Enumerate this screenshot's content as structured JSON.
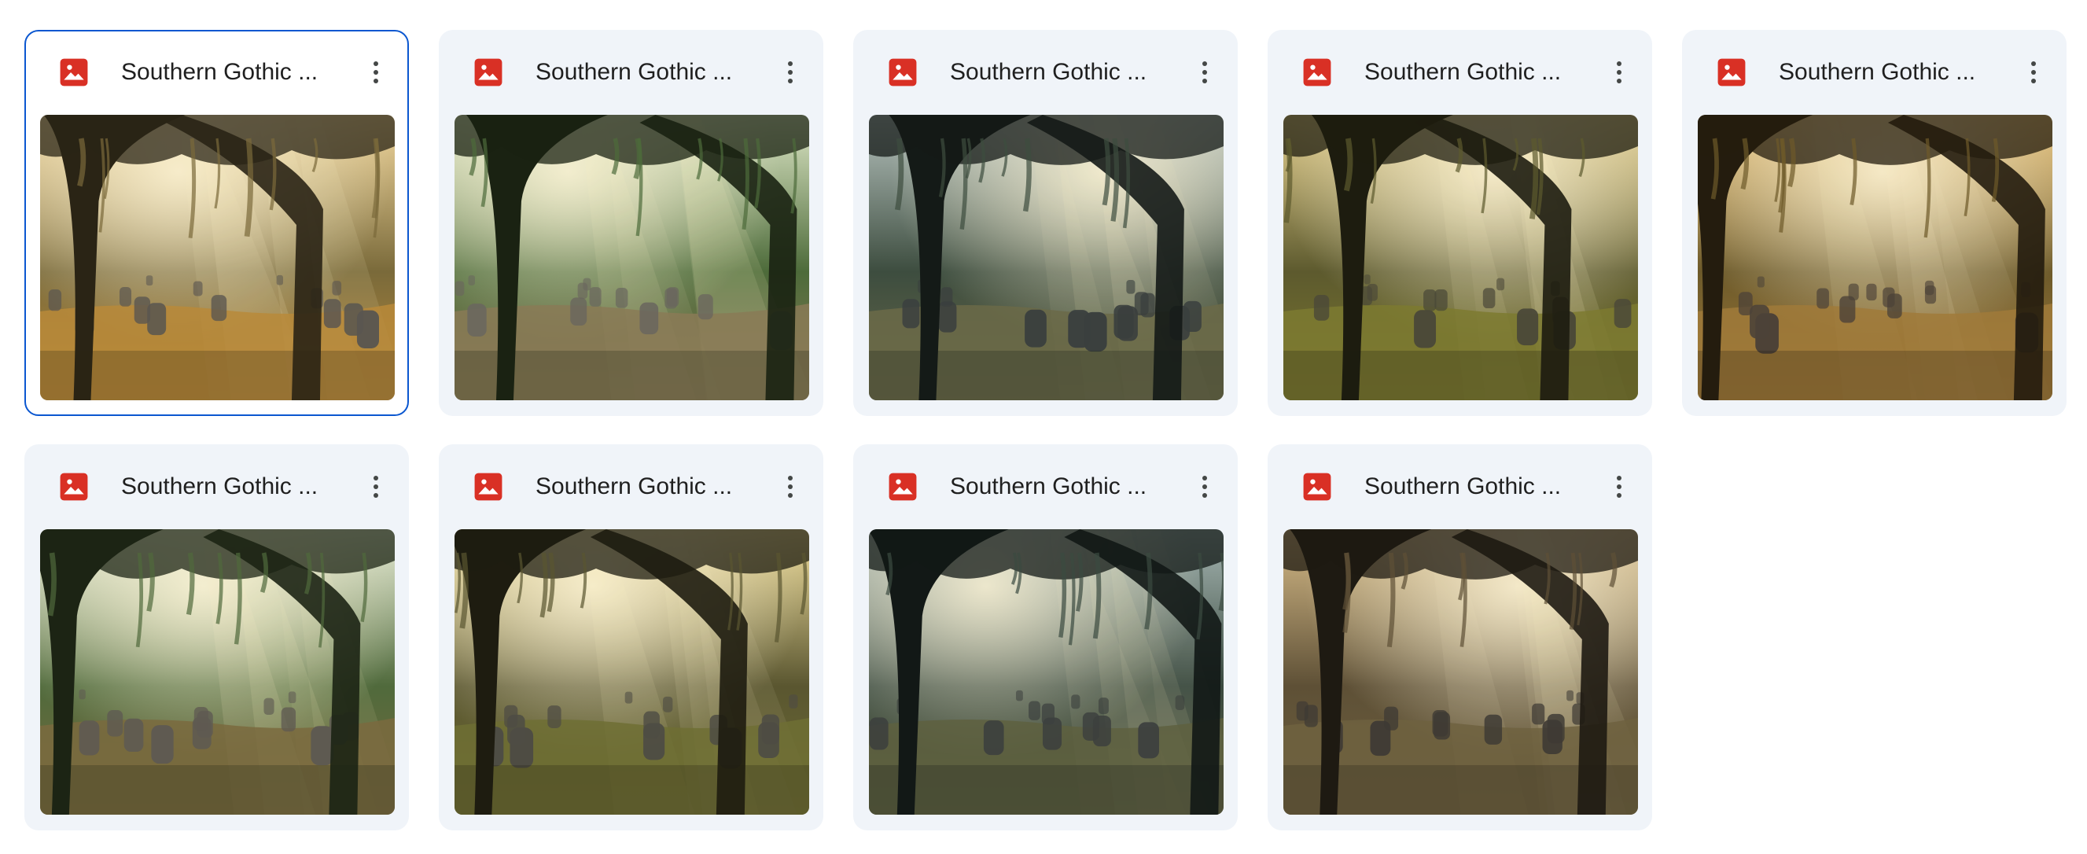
{
  "files": [
    {
      "name": "Southern Gothic ...",
      "type_icon": "image-file-icon",
      "more_icon": "more-vert-icon",
      "selected": true,
      "palette": {
        "sky": "#f3d9a0",
        "mid": "#7a6a3a",
        "dark": "#2a2415",
        "ground": "#b98a3a",
        "stone": "#5a5650"
      }
    },
    {
      "name": "Southern Gothic ...",
      "type_icon": "image-file-icon",
      "more_icon": "more-vert-icon",
      "selected": false,
      "palette": {
        "sky": "#dfe8c8",
        "mid": "#4d6b3a",
        "dark": "#1a2212",
        "ground": "#8a7a56",
        "stone": "#6a665e"
      }
    },
    {
      "name": "Southern Gothic ...",
      "type_icon": "image-file-icon",
      "more_icon": "more-vert-icon",
      "selected": false,
      "palette": {
        "sky": "#b8c4c0",
        "mid": "#3d4d3f",
        "dark": "#141a17",
        "ground": "#6b6a48",
        "stone": "#3a3f3e"
      }
    },
    {
      "name": "Southern Gothic ...",
      "type_icon": "image-file-icon",
      "more_icon": "more-vert-icon",
      "selected": false,
      "palette": {
        "sky": "#e4cf8e",
        "mid": "#5d5a2e",
        "dark": "#1d1c0f",
        "ground": "#7d7a30",
        "stone": "#4a4838"
      }
    },
    {
      "name": "Southern Gothic ...",
      "type_icon": "image-file-icon",
      "more_icon": "more-vert-icon",
      "selected": false,
      "palette": {
        "sky": "#e8c27a",
        "mid": "#6d5a2a",
        "dark": "#241c0e",
        "ground": "#a07a3a",
        "stone": "#4c4238"
      }
    },
    {
      "name": "Southern Gothic ...",
      "type_icon": "image-file-icon",
      "more_icon": "more-vert-icon",
      "selected": false,
      "palette": {
        "sky": "#e6ecd6",
        "mid": "#506a3c",
        "dark": "#1c2414",
        "ground": "#7a6a3e",
        "stone": "#5e5a52"
      }
    },
    {
      "name": "Southern Gothic ...",
      "type_icon": "image-file-icon",
      "more_icon": "more-vert-icon",
      "selected": false,
      "palette": {
        "sky": "#f2e0a0",
        "mid": "#5a5630",
        "dark": "#1e1c10",
        "ground": "#6e6e34",
        "stone": "#4e4c44"
      }
    },
    {
      "name": "Southern Gothic ...",
      "type_icon": "image-file-icon",
      "more_icon": "more-vert-icon",
      "selected": false,
      "palette": {
        "sky": "#a8b8b4",
        "mid": "#3a4a40",
        "dark": "#121816",
        "ground": "#5e6040",
        "stone": "#3c403e"
      }
    },
    {
      "name": "Southern Gothic ...",
      "type_icon": "image-file-icon",
      "more_icon": "more-vert-icon",
      "selected": false,
      "palette": {
        "sky": "#d8bd8a",
        "mid": "#5e5036",
        "dark": "#1e1a12",
        "ground": "#6e6240",
        "stone": "#3e3a34"
      }
    }
  ],
  "colors": {
    "card_bg": "#f0f4f9",
    "selected_border": "#0b57d0",
    "image_icon": "#d93025",
    "text": "#1f1f1f"
  }
}
